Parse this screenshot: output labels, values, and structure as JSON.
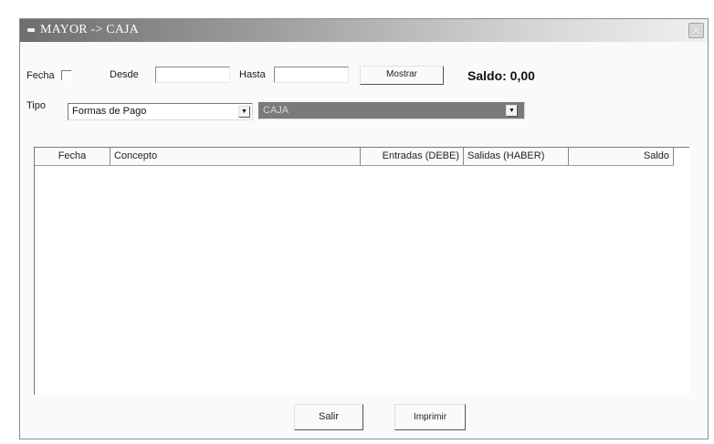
{
  "window": {
    "title": "MAYOR -> CAJA",
    "close_label": "✕"
  },
  "filters": {
    "fecha_label": "Fecha",
    "desde_label": "Desde",
    "desde_value": "",
    "hasta_label": "Hasta",
    "hasta_value": "",
    "mostrar_label": "Mostrar",
    "saldo_text": "Saldo: 0,00",
    "tipo_label": "Tipo",
    "tipo_value": "Formas de Pago",
    "cuenta_value": "CAJA"
  },
  "grid": {
    "columns": [
      "Fecha",
      "Concepto",
      "Entradas (DEBE)",
      "Salidas (HABER)",
      "Saldo"
    ],
    "rows": []
  },
  "footer": {
    "salir_label": "Salir",
    "imprimir_label": "Imprimir"
  },
  "colors": {
    "selected_combo_bg": "#7a7a7a",
    "titlebar_start": "#6e6e6e"
  },
  "icons": {
    "title": "window-menu-icon",
    "close": "close-icon",
    "dropdown": "chevron-down-icon"
  }
}
